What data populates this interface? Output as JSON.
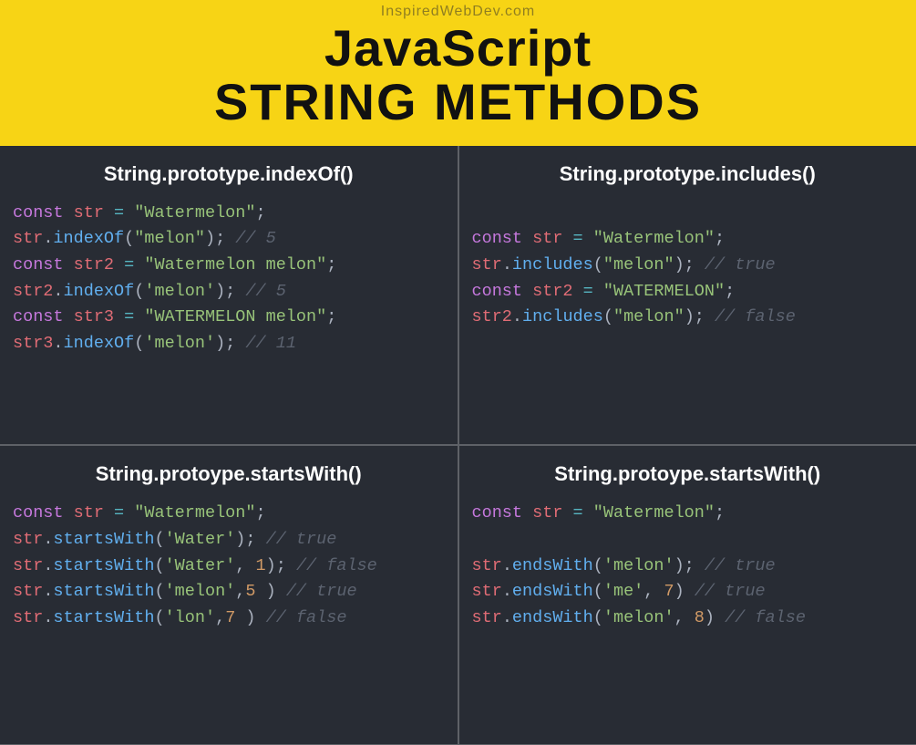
{
  "header": {
    "site": "InspiredWebDev.com",
    "title_line1": "JavaScript",
    "title_line2": "STRING METHODS"
  },
  "cells": [
    {
      "title": "String.prototype.indexOf()",
      "code": [
        [
          {
            "t": "const ",
            "cls": "k"
          },
          {
            "t": "str",
            "cls": "v"
          },
          {
            "t": " ",
            "cls": "op"
          },
          {
            "t": "=",
            "cls": "eq"
          },
          {
            "t": " ",
            "cls": "op"
          },
          {
            "t": "\"Watermelon\"",
            "cls": "s"
          },
          {
            "t": ";",
            "cls": "op"
          }
        ],
        [
          {
            "t": "str",
            "cls": "v"
          },
          {
            "t": ".",
            "cls": "op"
          },
          {
            "t": "indexOf",
            "cls": "fn"
          },
          {
            "t": "(",
            "cls": "op"
          },
          {
            "t": "\"melon\"",
            "cls": "s"
          },
          {
            "t": ");",
            "cls": "op"
          },
          {
            "t": " ",
            "cls": "op"
          },
          {
            "t": "// 5",
            "cls": "c"
          }
        ],
        [
          {
            "t": "const ",
            "cls": "k"
          },
          {
            "t": "str2",
            "cls": "v"
          },
          {
            "t": " ",
            "cls": "op"
          },
          {
            "t": "=",
            "cls": "eq"
          },
          {
            "t": " ",
            "cls": "op"
          },
          {
            "t": "\"Watermelon melon\"",
            "cls": "s"
          },
          {
            "t": ";",
            "cls": "op"
          }
        ],
        [
          {
            "t": "str2",
            "cls": "v"
          },
          {
            "t": ".",
            "cls": "op"
          },
          {
            "t": "indexOf",
            "cls": "fn"
          },
          {
            "t": "(",
            "cls": "op"
          },
          {
            "t": "'melon'",
            "cls": "s"
          },
          {
            "t": ");",
            "cls": "op"
          },
          {
            "t": " ",
            "cls": "op"
          },
          {
            "t": "// 5",
            "cls": "c"
          }
        ],
        [
          {
            "t": "const ",
            "cls": "k"
          },
          {
            "t": "str3",
            "cls": "v"
          },
          {
            "t": " ",
            "cls": "op"
          },
          {
            "t": "=",
            "cls": "eq"
          },
          {
            "t": " ",
            "cls": "op"
          },
          {
            "t": "\"WATERMELON melon\"",
            "cls": "s"
          },
          {
            "t": ";",
            "cls": "op"
          }
        ],
        [
          {
            "t": "str3",
            "cls": "v"
          },
          {
            "t": ".",
            "cls": "op"
          },
          {
            "t": "indexOf",
            "cls": "fn"
          },
          {
            "t": "(",
            "cls": "op"
          },
          {
            "t": "'melon'",
            "cls": "s"
          },
          {
            "t": ");",
            "cls": "op"
          },
          {
            "t": " ",
            "cls": "op"
          },
          {
            "t": "// 11",
            "cls": "c"
          }
        ]
      ]
    },
    {
      "title": "String.prototype.includes()",
      "code": [
        [],
        [
          {
            "t": "const ",
            "cls": "k"
          },
          {
            "t": "str",
            "cls": "v"
          },
          {
            "t": " ",
            "cls": "op"
          },
          {
            "t": "=",
            "cls": "eq"
          },
          {
            "t": " ",
            "cls": "op"
          },
          {
            "t": "\"Watermelon\"",
            "cls": "s"
          },
          {
            "t": ";",
            "cls": "op"
          }
        ],
        [
          {
            "t": "str",
            "cls": "v"
          },
          {
            "t": ".",
            "cls": "op"
          },
          {
            "t": "includes",
            "cls": "fn"
          },
          {
            "t": "(",
            "cls": "op"
          },
          {
            "t": "\"melon\"",
            "cls": "s"
          },
          {
            "t": ");",
            "cls": "op"
          },
          {
            "t": " ",
            "cls": "op"
          },
          {
            "t": "// true",
            "cls": "c"
          }
        ],
        [
          {
            "t": "const ",
            "cls": "k"
          },
          {
            "t": "str2",
            "cls": "v"
          },
          {
            "t": " ",
            "cls": "op"
          },
          {
            "t": "=",
            "cls": "eq"
          },
          {
            "t": " ",
            "cls": "op"
          },
          {
            "t": "\"WATERMELON\"",
            "cls": "s"
          },
          {
            "t": ";",
            "cls": "op"
          }
        ],
        [
          {
            "t": "str2",
            "cls": "v"
          },
          {
            "t": ".",
            "cls": "op"
          },
          {
            "t": "includes",
            "cls": "fn"
          },
          {
            "t": "(",
            "cls": "op"
          },
          {
            "t": "\"melon\"",
            "cls": "s"
          },
          {
            "t": ");",
            "cls": "op"
          },
          {
            "t": " ",
            "cls": "op"
          },
          {
            "t": "// false",
            "cls": "c"
          }
        ]
      ]
    },
    {
      "title": "String.protoype.startsWith()",
      "code": [
        [
          {
            "t": "const ",
            "cls": "k"
          },
          {
            "t": "str",
            "cls": "v"
          },
          {
            "t": " ",
            "cls": "op"
          },
          {
            "t": "=",
            "cls": "eq"
          },
          {
            "t": " ",
            "cls": "op"
          },
          {
            "t": "\"Watermelon\"",
            "cls": "s"
          },
          {
            "t": ";",
            "cls": "op"
          }
        ],
        [
          {
            "t": "str",
            "cls": "v"
          },
          {
            "t": ".",
            "cls": "op"
          },
          {
            "t": "startsWith",
            "cls": "fn"
          },
          {
            "t": "(",
            "cls": "op"
          },
          {
            "t": "'Water'",
            "cls": "s"
          },
          {
            "t": ");",
            "cls": "op"
          },
          {
            "t": " ",
            "cls": "op"
          },
          {
            "t": "// true",
            "cls": "c"
          }
        ],
        [
          {
            "t": "str",
            "cls": "v"
          },
          {
            "t": ".",
            "cls": "op"
          },
          {
            "t": "startsWith",
            "cls": "fn"
          },
          {
            "t": "(",
            "cls": "op"
          },
          {
            "t": "'Water'",
            "cls": "s"
          },
          {
            "t": ", ",
            "cls": "op"
          },
          {
            "t": "1",
            "cls": "n"
          },
          {
            "t": ");",
            "cls": "op"
          },
          {
            "t": " ",
            "cls": "op"
          },
          {
            "t": "// false",
            "cls": "c"
          }
        ],
        [
          {
            "t": "str",
            "cls": "v"
          },
          {
            "t": ".",
            "cls": "op"
          },
          {
            "t": "startsWith",
            "cls": "fn"
          },
          {
            "t": "(",
            "cls": "op"
          },
          {
            "t": "'melon'",
            "cls": "s"
          },
          {
            "t": ",",
            "cls": "op"
          },
          {
            "t": "5",
            "cls": "n"
          },
          {
            "t": " )",
            "cls": "op"
          },
          {
            "t": " ",
            "cls": "op"
          },
          {
            "t": "// true",
            "cls": "c"
          }
        ],
        [
          {
            "t": "str",
            "cls": "v"
          },
          {
            "t": ".",
            "cls": "op"
          },
          {
            "t": "startsWith",
            "cls": "fn"
          },
          {
            "t": "(",
            "cls": "op"
          },
          {
            "t": "'lon'",
            "cls": "s"
          },
          {
            "t": ",",
            "cls": "op"
          },
          {
            "t": "7",
            "cls": "n"
          },
          {
            "t": " )",
            "cls": "op"
          },
          {
            "t": " ",
            "cls": "op"
          },
          {
            "t": "// false",
            "cls": "c"
          }
        ]
      ]
    },
    {
      "title": "String.protoype.startsWith()",
      "code": [
        [
          {
            "t": "const ",
            "cls": "k"
          },
          {
            "t": "str",
            "cls": "v"
          },
          {
            "t": " ",
            "cls": "op"
          },
          {
            "t": "=",
            "cls": "eq"
          },
          {
            "t": " ",
            "cls": "op"
          },
          {
            "t": "\"Watermelon\"",
            "cls": "s"
          },
          {
            "t": ";",
            "cls": "op"
          }
        ],
        [],
        [
          {
            "t": "str",
            "cls": "v"
          },
          {
            "t": ".",
            "cls": "op"
          },
          {
            "t": "endsWith",
            "cls": "fn"
          },
          {
            "t": "(",
            "cls": "op"
          },
          {
            "t": "'melon'",
            "cls": "s"
          },
          {
            "t": ");",
            "cls": "op"
          },
          {
            "t": " ",
            "cls": "op"
          },
          {
            "t": "// true",
            "cls": "c"
          }
        ],
        [
          {
            "t": "str",
            "cls": "v"
          },
          {
            "t": ".",
            "cls": "op"
          },
          {
            "t": "endsWith",
            "cls": "fn"
          },
          {
            "t": "(",
            "cls": "op"
          },
          {
            "t": "'me'",
            "cls": "s"
          },
          {
            "t": ", ",
            "cls": "op"
          },
          {
            "t": "7",
            "cls": "n"
          },
          {
            "t": ")",
            "cls": "op"
          },
          {
            "t": " ",
            "cls": "op"
          },
          {
            "t": "// true",
            "cls": "c"
          }
        ],
        [
          {
            "t": "str",
            "cls": "v"
          },
          {
            "t": ".",
            "cls": "op"
          },
          {
            "t": "endsWith",
            "cls": "fn"
          },
          {
            "t": "(",
            "cls": "op"
          },
          {
            "t": "'melon'",
            "cls": "s"
          },
          {
            "t": ", ",
            "cls": "op"
          },
          {
            "t": "8",
            "cls": "n"
          },
          {
            "t": ")",
            "cls": "op"
          },
          {
            "t": " ",
            "cls": "op"
          },
          {
            "t": "// false",
            "cls": "c"
          }
        ]
      ]
    }
  ]
}
